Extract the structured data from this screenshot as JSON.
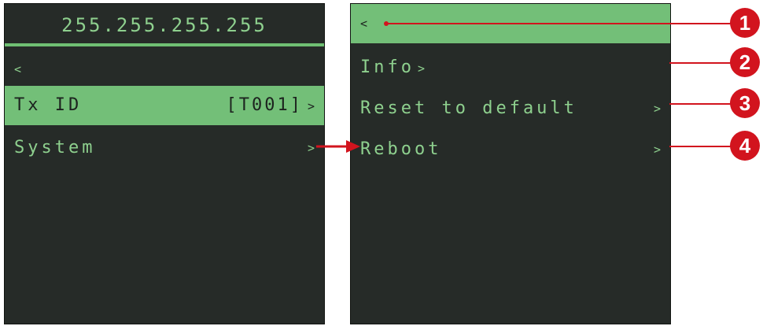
{
  "left_panel": {
    "ip_address": "255.255.255.255",
    "back_icon": "<",
    "items": [
      {
        "label": "Tx ID",
        "value": "[T001]",
        "chevron": ">"
      },
      {
        "label": "System",
        "value": "",
        "chevron": ">"
      }
    ]
  },
  "right_panel": {
    "back_icon": "<",
    "items": [
      {
        "label": "Info",
        "chevron": ">"
      },
      {
        "label": "Reset to default",
        "chevron": ">"
      },
      {
        "label": "Reboot",
        "chevron": ">"
      }
    ]
  },
  "callouts": [
    "1",
    "2",
    "3",
    "4"
  ],
  "colors": {
    "screen_bg": "#262b28",
    "accent_green": "#73bf78",
    "text_green": "#8ed08e",
    "callout_red": "#d2141e"
  }
}
